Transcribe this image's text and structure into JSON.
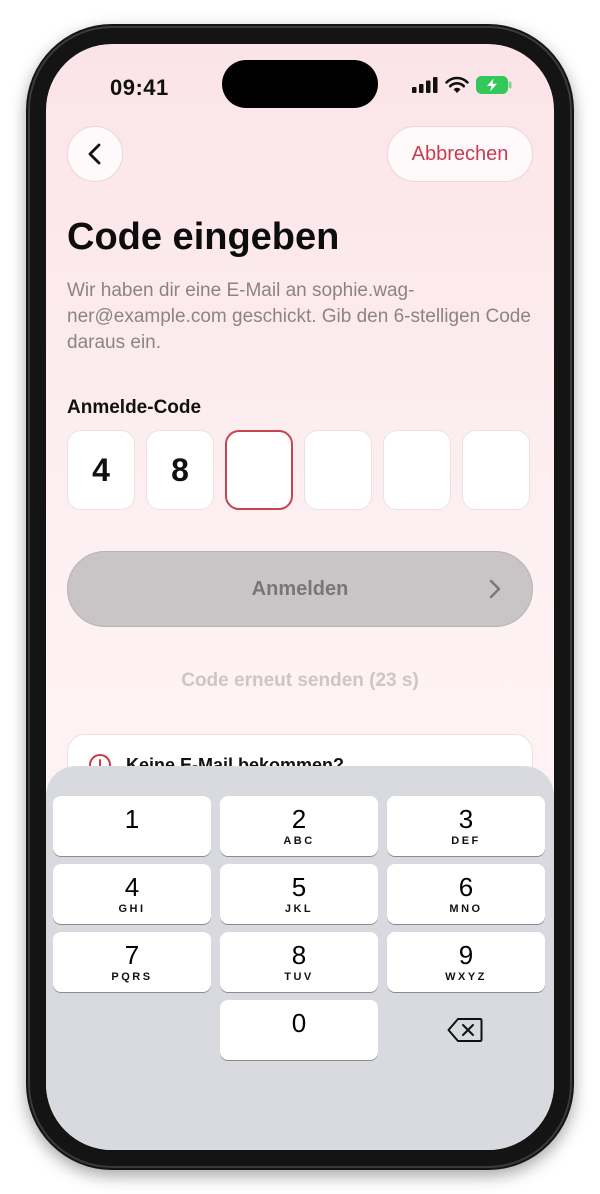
{
  "status_bar": {
    "time": "09:41"
  },
  "nav": {
    "back_icon": "chevron-left-icon",
    "cancel_label": "Abbrechen"
  },
  "title": "Code eingeben",
  "subtitle": "Wir haben dir eine E-Mail an sophie.wag-ner@example.com geschickt. Gib den 6-stelligen Code daraus ein.",
  "code": {
    "label": "Anmelde-Code",
    "digits": [
      "4",
      "8",
      "",
      "",
      "",
      ""
    ],
    "active_index": 2
  },
  "submit": {
    "label": "Anmelden",
    "icon": "chevron-right-icon"
  },
  "resend": {
    "label": "Code erneut senden (23 s)"
  },
  "info_card": {
    "icon": "info-icon",
    "title": "Keine E-Mail bekommen?"
  },
  "keyboard": {
    "keys": [
      {
        "num": "1",
        "letters": ""
      },
      {
        "num": "2",
        "letters": "ABC"
      },
      {
        "num": "3",
        "letters": "DEF"
      },
      {
        "num": "4",
        "letters": "GHI"
      },
      {
        "num": "5",
        "letters": "JKL"
      },
      {
        "num": "6",
        "letters": "MNO"
      },
      {
        "num": "7",
        "letters": "PQRS"
      },
      {
        "num": "8",
        "letters": "TUV"
      },
      {
        "num": "9",
        "letters": "WXYZ"
      },
      {
        "num": "0",
        "letters": ""
      }
    ],
    "delete_icon": "backspace-icon"
  },
  "colors": {
    "accent": "#c93b50",
    "active_border": "#c8444f",
    "battery": "#34c759"
  }
}
